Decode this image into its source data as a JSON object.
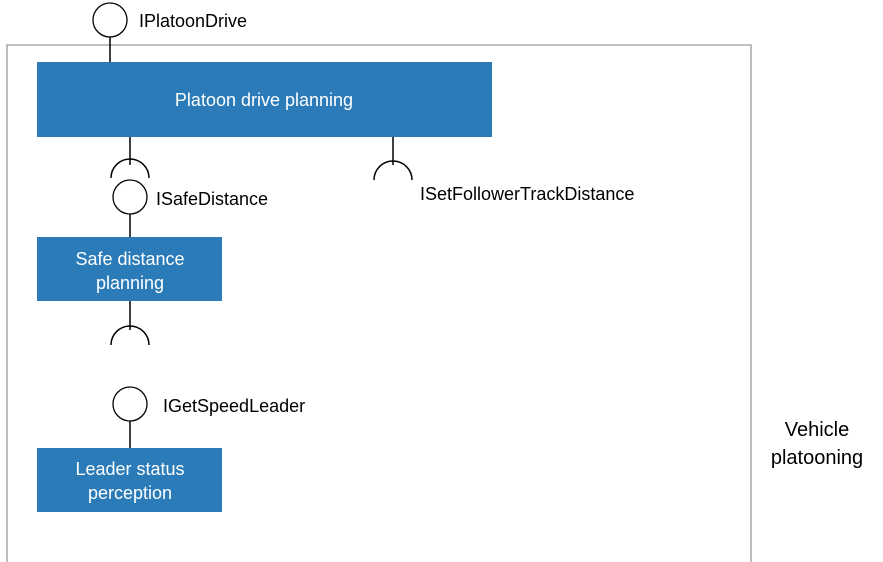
{
  "boundary": {
    "label_line1": "Vehicle",
    "label_line2": "platooning"
  },
  "components": {
    "platoon_drive_planning": "Platoon drive planning",
    "safe_distance_planning_line1": "Safe distance",
    "safe_distance_planning_line2": "planning",
    "leader_status_perception_line1": "Leader status",
    "leader_status_perception_line2": "perception"
  },
  "interfaces": {
    "platoon_drive": "IPlatoonDrive",
    "safe_distance": "ISafeDistance",
    "set_follower_track_distance": "ISetFollowerTrackDistance",
    "get_speed_leader": "IGetSpeedLeader"
  },
  "colors": {
    "component_fill": "#2b7bb9",
    "boundary_stroke": "#9a9a9a"
  }
}
